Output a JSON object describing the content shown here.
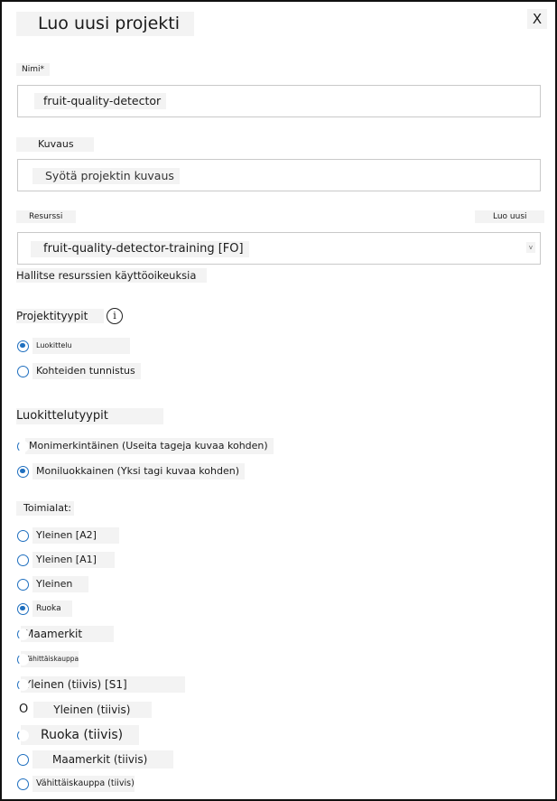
{
  "dialog": {
    "title": "Luo uusi projekti",
    "close_label": "X"
  },
  "name": {
    "label": "Nimi*",
    "value": "fruit-quality-detector"
  },
  "description": {
    "label": "Kuvaus",
    "placeholder": "Syötä projektin kuvaus"
  },
  "resource": {
    "label": "Resurssi",
    "create_new_label": "Luo uusi",
    "selected": "fruit-quality-detector-training [FO]",
    "caret": "v",
    "manage_link": "Hallitse resurssien käyttöoikeuksia"
  },
  "project_types": {
    "label": "Projektityypit",
    "info_glyph": "i",
    "options": [
      {
        "label": "Luokittelu",
        "checked": true
      },
      {
        "label": "Kohteiden tunnistus",
        "checked": false
      }
    ]
  },
  "classification_types": {
    "label": "Luokittelutyypit",
    "options": [
      {
        "label": "Monimerkintäinen (Useita tageja kuvaa kohden)",
        "checked": false
      },
      {
        "label": "Moniluokkainen (Yksi tagi kuvaa kohden)",
        "checked": true
      }
    ]
  },
  "domains": {
    "label": "Toimialat:",
    "options": [
      {
        "label": "Yleinen [A2]",
        "checked": false
      },
      {
        "label": "Yleinen [A1]",
        "checked": false
      },
      {
        "label": "Yleinen",
        "checked": false
      },
      {
        "label": "Ruoka",
        "checked": true
      },
      {
        "label": "Maamerkit",
        "checked": false
      },
      {
        "label": "Vähittäiskauppa",
        "checked": false
      },
      {
        "label": "Yleinen (tiivis) [S1]",
        "checked": false
      },
      {
        "label": "Yleinen (tiivis)",
        "checked": false,
        "marker": "O"
      },
      {
        "label": "Ruoka (tiivis)",
        "checked": false
      },
      {
        "label": "Maamerkit (tiivis)",
        "checked": false
      },
      {
        "label": "Vähittäiskauppa (tiivis)",
        "checked": false
      }
    ]
  },
  "colors": {
    "accent": "#1f6fbf",
    "label_bg": "#f3f3f3",
    "border": "#c9c9c9"
  }
}
